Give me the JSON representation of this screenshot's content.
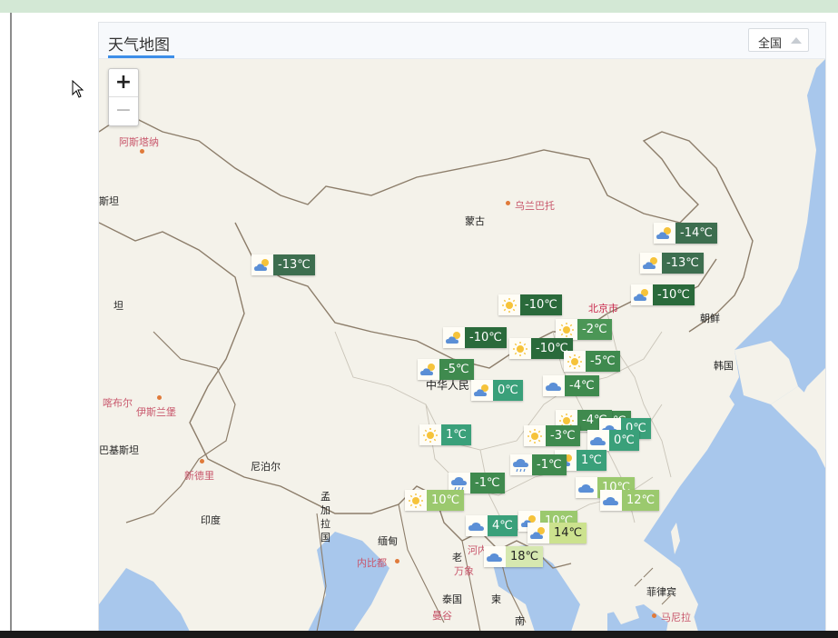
{
  "panel": {
    "title": "天气地图",
    "region_label": "全国"
  },
  "zoom": {
    "in_label": "+",
    "out_label": "−"
  },
  "places": {
    "astana": "阿斯塔纳",
    "ulaanbaatar": "乌兰巴托",
    "mongolia": "蒙古",
    "beijing": "北京市",
    "dpr_korea": "朝鲜",
    "korea": "韩国",
    "china": "中华人民",
    "kabul": "喀布尔",
    "islamabad": "伊斯兰堡",
    "pakistan": "巴基斯坦",
    "new_delhi": "新德里",
    "nepal": "尼泊尔",
    "india": "印度",
    "bangladesh": "孟\n加\n拉\n国",
    "myanmar": "缅甸",
    "naypyidaw": "内比都",
    "laos": "老",
    "vientiane": "万象",
    "hanoi": "河内",
    "thailand": "泰国",
    "bangkok": "曼谷",
    "cambodia": "柬",
    "south": "南",
    "philippines": "菲律宾",
    "manila": "马尼拉",
    "stan_frag": "斯坦",
    "tan_frag": "坦"
  },
  "markers": [
    {
      "temp": "-14℃",
      "icon": "partly-cloudy-icon",
      "color": "#3d6e4f"
    },
    {
      "temp": "-13℃",
      "icon": "partly-cloudy-icon",
      "color": "#3d6e4f"
    },
    {
      "temp": "-13℃",
      "icon": "partly-cloudy-icon",
      "color": "#3d6e4f"
    },
    {
      "temp": "-10℃",
      "icon": "partly-cloudy-icon",
      "color": "#2a6a3b"
    },
    {
      "temp": "-10℃",
      "icon": "sunny-icon",
      "color": "#2a6a3b"
    },
    {
      "temp": "-2℃",
      "icon": "sunny-icon",
      "color": "#4b9656"
    },
    {
      "temp": "-10℃",
      "icon": "partly-cloudy-icon",
      "color": "#2a6a3b"
    },
    {
      "temp": "-10℃",
      "icon": "sunny-icon",
      "color": "#2a6a3b"
    },
    {
      "temp": "-5℃",
      "icon": "sunny-icon",
      "color": "#3f8a4e"
    },
    {
      "temp": "-5℃",
      "icon": "partly-cloudy-icon",
      "color": "#3f8a4e"
    },
    {
      "temp": "-4℃",
      "icon": "cloudy-icon",
      "color": "#3f8a4e"
    },
    {
      "temp": "0℃",
      "icon": "partly-cloudy-icon",
      "color": "#3aa07a"
    },
    {
      "temp": "-4℃",
      "icon": "partly-cloudy-icon",
      "color": "#3f8a4e"
    },
    {
      "temp": "-4℃",
      "icon": "sunny-icon",
      "color": "#3f8a4e"
    },
    {
      "temp": "0℃",
      "icon": "cloudy-icon",
      "color": "#3aa07a"
    },
    {
      "temp": "0℃",
      "icon": "cloudy-icon",
      "color": "#3aa07a"
    },
    {
      "temp": "1℃",
      "icon": "sunny-icon",
      "color": "#3aa07a"
    },
    {
      "temp": "-3℃",
      "icon": "sunny-icon",
      "color": "#3f8a4e"
    },
    {
      "temp": "1℃",
      "icon": "partly-cloudy-icon",
      "color": "#3aa07a"
    },
    {
      "temp": "-1℃",
      "icon": "rain-icon",
      "color": "#3f8a4e"
    },
    {
      "temp": "-1℃",
      "icon": "rain-icon",
      "color": "#3f8a4e"
    },
    {
      "temp": "10℃",
      "icon": "cloudy-icon",
      "color": "#9bc96e"
    },
    {
      "temp": "12℃",
      "icon": "cloudy-icon",
      "color": "#9bc96e"
    },
    {
      "temp": "10℃",
      "icon": "sunny-icon",
      "color": "#9bc96e"
    },
    {
      "temp": "4℃",
      "icon": "cloudy-icon",
      "color": "#3aa07a"
    },
    {
      "temp": "10℃",
      "icon": "partly-cloudy-icon",
      "color": "#9bc96e"
    },
    {
      "temp": "14℃",
      "icon": "partly-cloudy-icon",
      "color": "#cce28e",
      "text_color": "#222"
    },
    {
      "temp": "18℃",
      "icon": "cloudy-icon",
      "color": "#d6e8b0",
      "text_color": "#222"
    }
  ]
}
